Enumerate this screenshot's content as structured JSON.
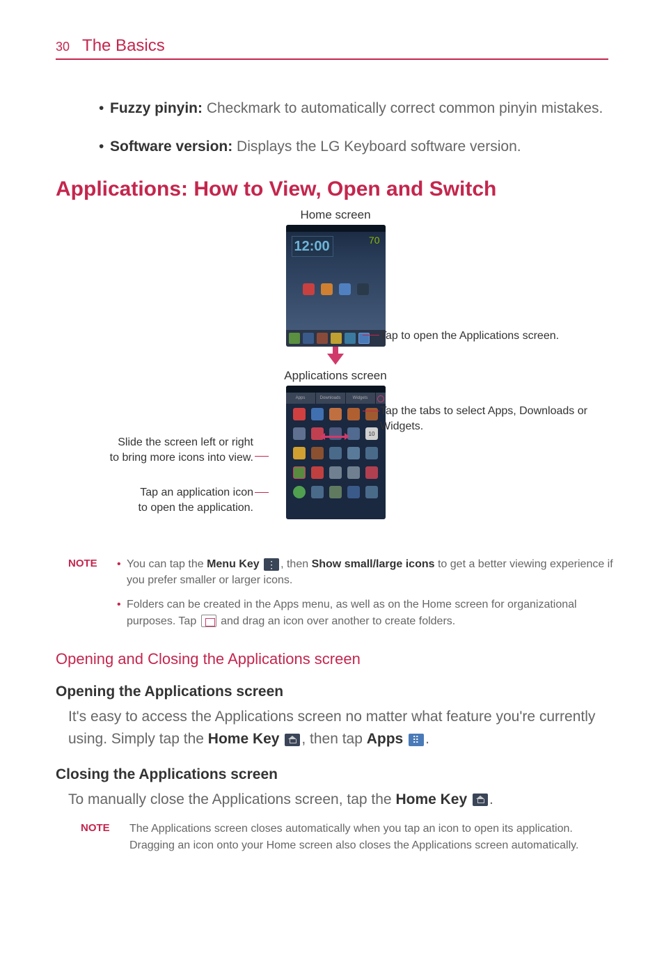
{
  "header": {
    "page_number": "30",
    "section": "The Basics"
  },
  "bullets": {
    "fuzzy_pinyin_label": "Fuzzy pinyin:",
    "fuzzy_pinyin_text": " Checkmark to automatically correct common pinyin mistakes.",
    "software_version_label": "Software version:",
    "software_version_text": " Displays the LG Keyboard software version."
  },
  "main_heading": "Applications: How to View, Open and Switch",
  "diagram": {
    "home_screen_label": "Home screen",
    "apps_screen_label": "Applications screen",
    "clock_time": "12:00",
    "callout_apps_button": "Tap to open the Applications screen.",
    "callout_tabs": "Tap the tabs to select Apps, Downloads or Widgets.",
    "callout_slide_left": "Slide the screen left or right",
    "callout_slide_right": "to bring more icons into view.",
    "callout_tap_icon_1": "Tap an application icon",
    "callout_tap_icon_2": "to open the application.",
    "tab_apps": "Apps",
    "tab_downloads": "Downloads",
    "tab_widgets": "Widgets"
  },
  "note1": {
    "label": "NOTE",
    "line1a": "You can tap the ",
    "menu_key": "Menu Key",
    "line1b": ", then ",
    "show_icons": "Show small/large icons",
    "line1c": " to get a better viewing experience if you prefer smaller or larger icons.",
    "line2a": "Folders can be created in the Apps menu, as well as on the Home screen for organizational purposes. Tap ",
    "line2b": " and drag an icon over another to create folders."
  },
  "section_opening_closing": "Opening and Closing the Applications screen",
  "opening": {
    "heading": "Opening the Applications screen",
    "text1": "It's easy to access the Applications screen no matter what feature you're currently using. Simply tap the ",
    "home_key": "Home Key",
    "text2": ", then tap ",
    "apps": "Apps",
    "text3": "."
  },
  "closing": {
    "heading": "Closing the Applications screen",
    "text1": "To manually close the Applications screen, tap the ",
    "home_key": "Home Key",
    "text2": "."
  },
  "note2": {
    "label": "NOTE",
    "text": "The Applications screen closes automatically when you tap an icon to open its application. Dragging an icon onto your Home screen also closes the Applications screen automatically."
  }
}
